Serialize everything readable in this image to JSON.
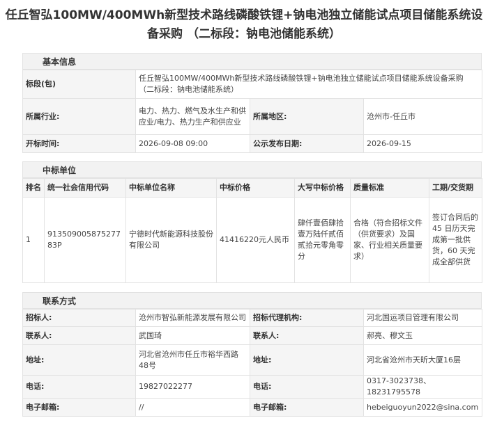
{
  "title": {
    "line1": "任丘智弘100MW/400MWh新型技术路线磷酸铁锂+钠电池独立储能试点项目储能系统设",
    "line2": "备采购 （二标段：钠电池储能系统）"
  },
  "basic": {
    "heading": "基本信息",
    "bid_section_label": "标段(包)",
    "bid_section_value": "任丘智弘100MW/400MWh新型技术路线磷酸铁锂+钠电池独立储能试点项目储能系统设备采购 （二标段：钠电池储能系统）",
    "industry_label": "所属行业:",
    "industry_value": "电力、热力、燃气及水生产和供应业/电力、热力生产和供应业",
    "region_label": "所属地区:",
    "region_value": "沧州市-任丘市",
    "open_time_label": "开标时间:",
    "open_time_value": "2026-09-08 09:00",
    "publish_date_label": "公示发布日期:",
    "publish_date_value": "2026-09-15"
  },
  "winner": {
    "heading": "中标单位",
    "columns": [
      "排名",
      "统一社会信用代码",
      "中标单位名称",
      "中标价格",
      "大写中标价格",
      "质量标准",
      "工期/交货期"
    ],
    "row": {
      "rank": "1",
      "credit_code": "91350900587527783P",
      "company": "宁德时代新能源科技股份有限公司",
      "price": "41416220元人民币",
      "price_upper": "肆仟壹佰肆拾壹万陆仟贰佰贰拾元零角零分",
      "quality": "合格（符合招标文件（供货要求）及国家、行业相关质量要求）",
      "period": "签订合同后的 45 日历天完成第一批供货，60 天完成全部供货"
    }
  },
  "contact": {
    "heading": "联系方式",
    "tenderer_label": "招标人:",
    "tenderer_value": "沧州市智弘新能源发展有限公司",
    "agency_label": "招标代理机构:",
    "agency_value": "河北国运项目管理有限公司",
    "contact_label_1": "联系人:",
    "contact_value_1": "武国琦",
    "contact_label_2": "联系人:",
    "contact_value_2": "郝亮、穆文玉",
    "address_label_1": "地址:",
    "address_value_1": "河北省沧州市任丘市裕华西路48号",
    "address_label_2": "地址:",
    "address_value_2": "河北省沧州市天昕大厦16层",
    "phone_label_1": "电话:",
    "phone_value_1": "19827022277",
    "phone_label_2": "电话:",
    "phone_value_2": "0317-3023738、18231795578",
    "email_label_1": "电子邮箱:",
    "email_value_1": "//",
    "email_label_2": "电子邮箱:",
    "email_value_2": "hebeiguoyun2022@sina.com"
  }
}
